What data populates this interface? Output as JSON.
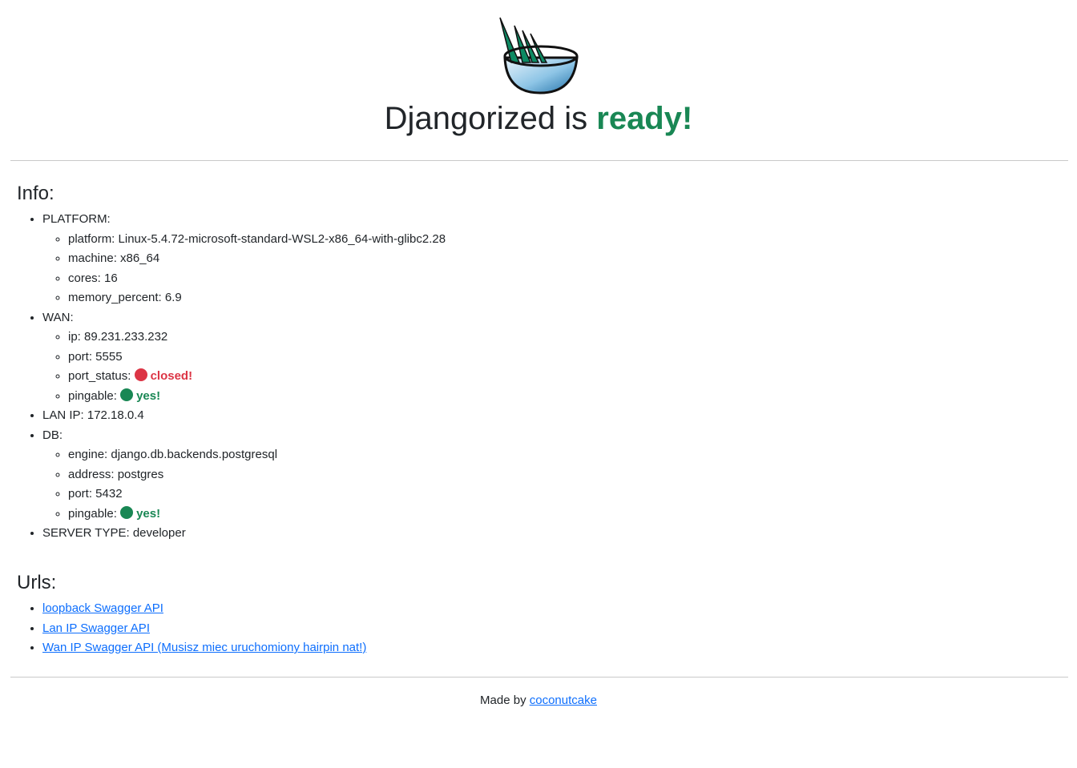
{
  "header": {
    "title_prefix": "Djangorized is ",
    "title_emphasis": "ready!"
  },
  "info": {
    "heading": "Info:",
    "platform": {
      "label": "PLATFORM:",
      "items": [
        "platform: Linux-5.4.72-microsoft-standard-WSL2-x86_64-with-glibc2.28",
        "machine: x86_64",
        "cores: 16",
        "memory_percent: 6.9"
      ]
    },
    "wan": {
      "label": "WAN:",
      "ip": "ip: 89.231.233.232",
      "port": "port: 5555",
      "port_status_label": "port_status:",
      "port_status_value": "closed!",
      "pingable_label": "pingable:",
      "pingable_value": "yes!"
    },
    "lan": "LAN IP: 172.18.0.4",
    "db": {
      "label": "DB:",
      "engine": "engine: django.db.backends.postgresql",
      "address": "address: postgres",
      "port": "port: 5432",
      "pingable_label": "pingable:",
      "pingable_value": "yes!"
    },
    "server_type": "SERVER TYPE: developer"
  },
  "urls": {
    "heading": "Urls:",
    "links": [
      "loopback Swagger API",
      "Lan IP Swagger API",
      "Wan IP Swagger API (Musisz miec uruchomiony hairpin nat!)"
    ]
  },
  "footer": {
    "made_by": "Made by ",
    "author": "coconutcake"
  },
  "colors": {
    "success": "#198754",
    "danger": "#dc3545",
    "link": "#0d6efd"
  },
  "icons": [
    "django-bowl-logo-icon",
    "red-status-dot-icon",
    "green-status-dot-icon"
  ]
}
